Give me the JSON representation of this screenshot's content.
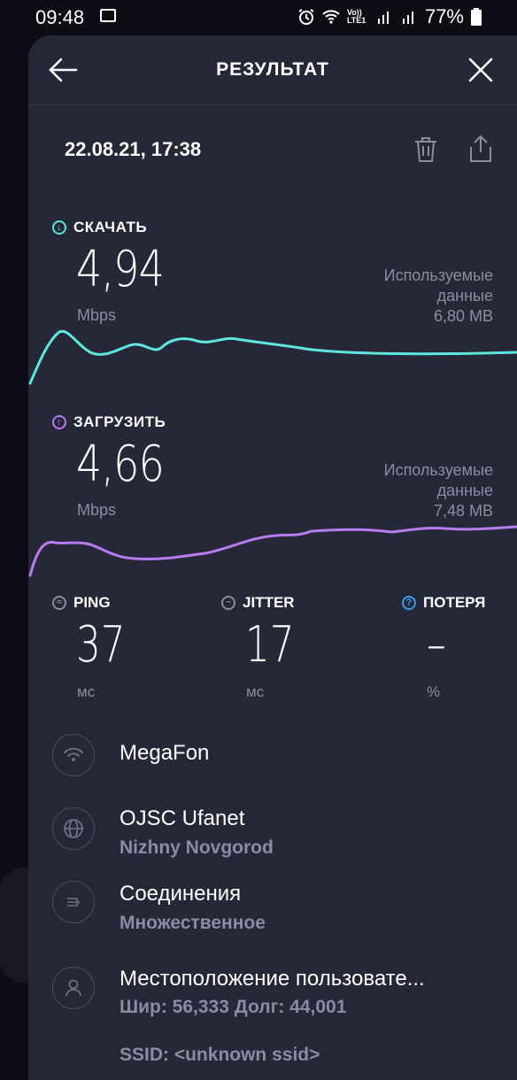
{
  "statusbar": {
    "time": "09:48",
    "battery": "77%",
    "signal_text": "Vo)) LTE1"
  },
  "header": {
    "title": "РЕЗУЛЬТАТ"
  },
  "result": {
    "date": "22.08.21, 17:38"
  },
  "download": {
    "label": "СКАЧАТЬ",
    "value": "4,94",
    "unit": "Mbps",
    "used_line1": "Используемые",
    "used_line2": "данные",
    "used_value": "6,80 MB",
    "color": "#5ee7df"
  },
  "upload": {
    "label": "ЗАГРУЗИТЬ",
    "value": "4,66",
    "unit": "Mbps",
    "used_line1": "Используемые",
    "used_line2": "данные",
    "used_value": "7,48 MB",
    "color": "#b77cf0"
  },
  "metrics": {
    "ping": {
      "label": "PING",
      "value": "37",
      "unit": "мс"
    },
    "jitter": {
      "label": "JITTER",
      "value": "17",
      "unit": "мс"
    },
    "loss": {
      "label": "ПОТЕРЯ",
      "value": "–",
      "unit": "%"
    }
  },
  "info": {
    "network": {
      "title": "MegaFon"
    },
    "provider": {
      "title": "OJSC Ufanet",
      "sub": "Nizhny Novgorod"
    },
    "connections": {
      "title": "Соединения",
      "sub": "Множественное"
    },
    "location": {
      "title": "Местоположение пользовате...",
      "sub": "Шир: 56,333 Долг: 44,001"
    },
    "ssid": {
      "text": "SSID: <unknown ssid>"
    }
  }
}
